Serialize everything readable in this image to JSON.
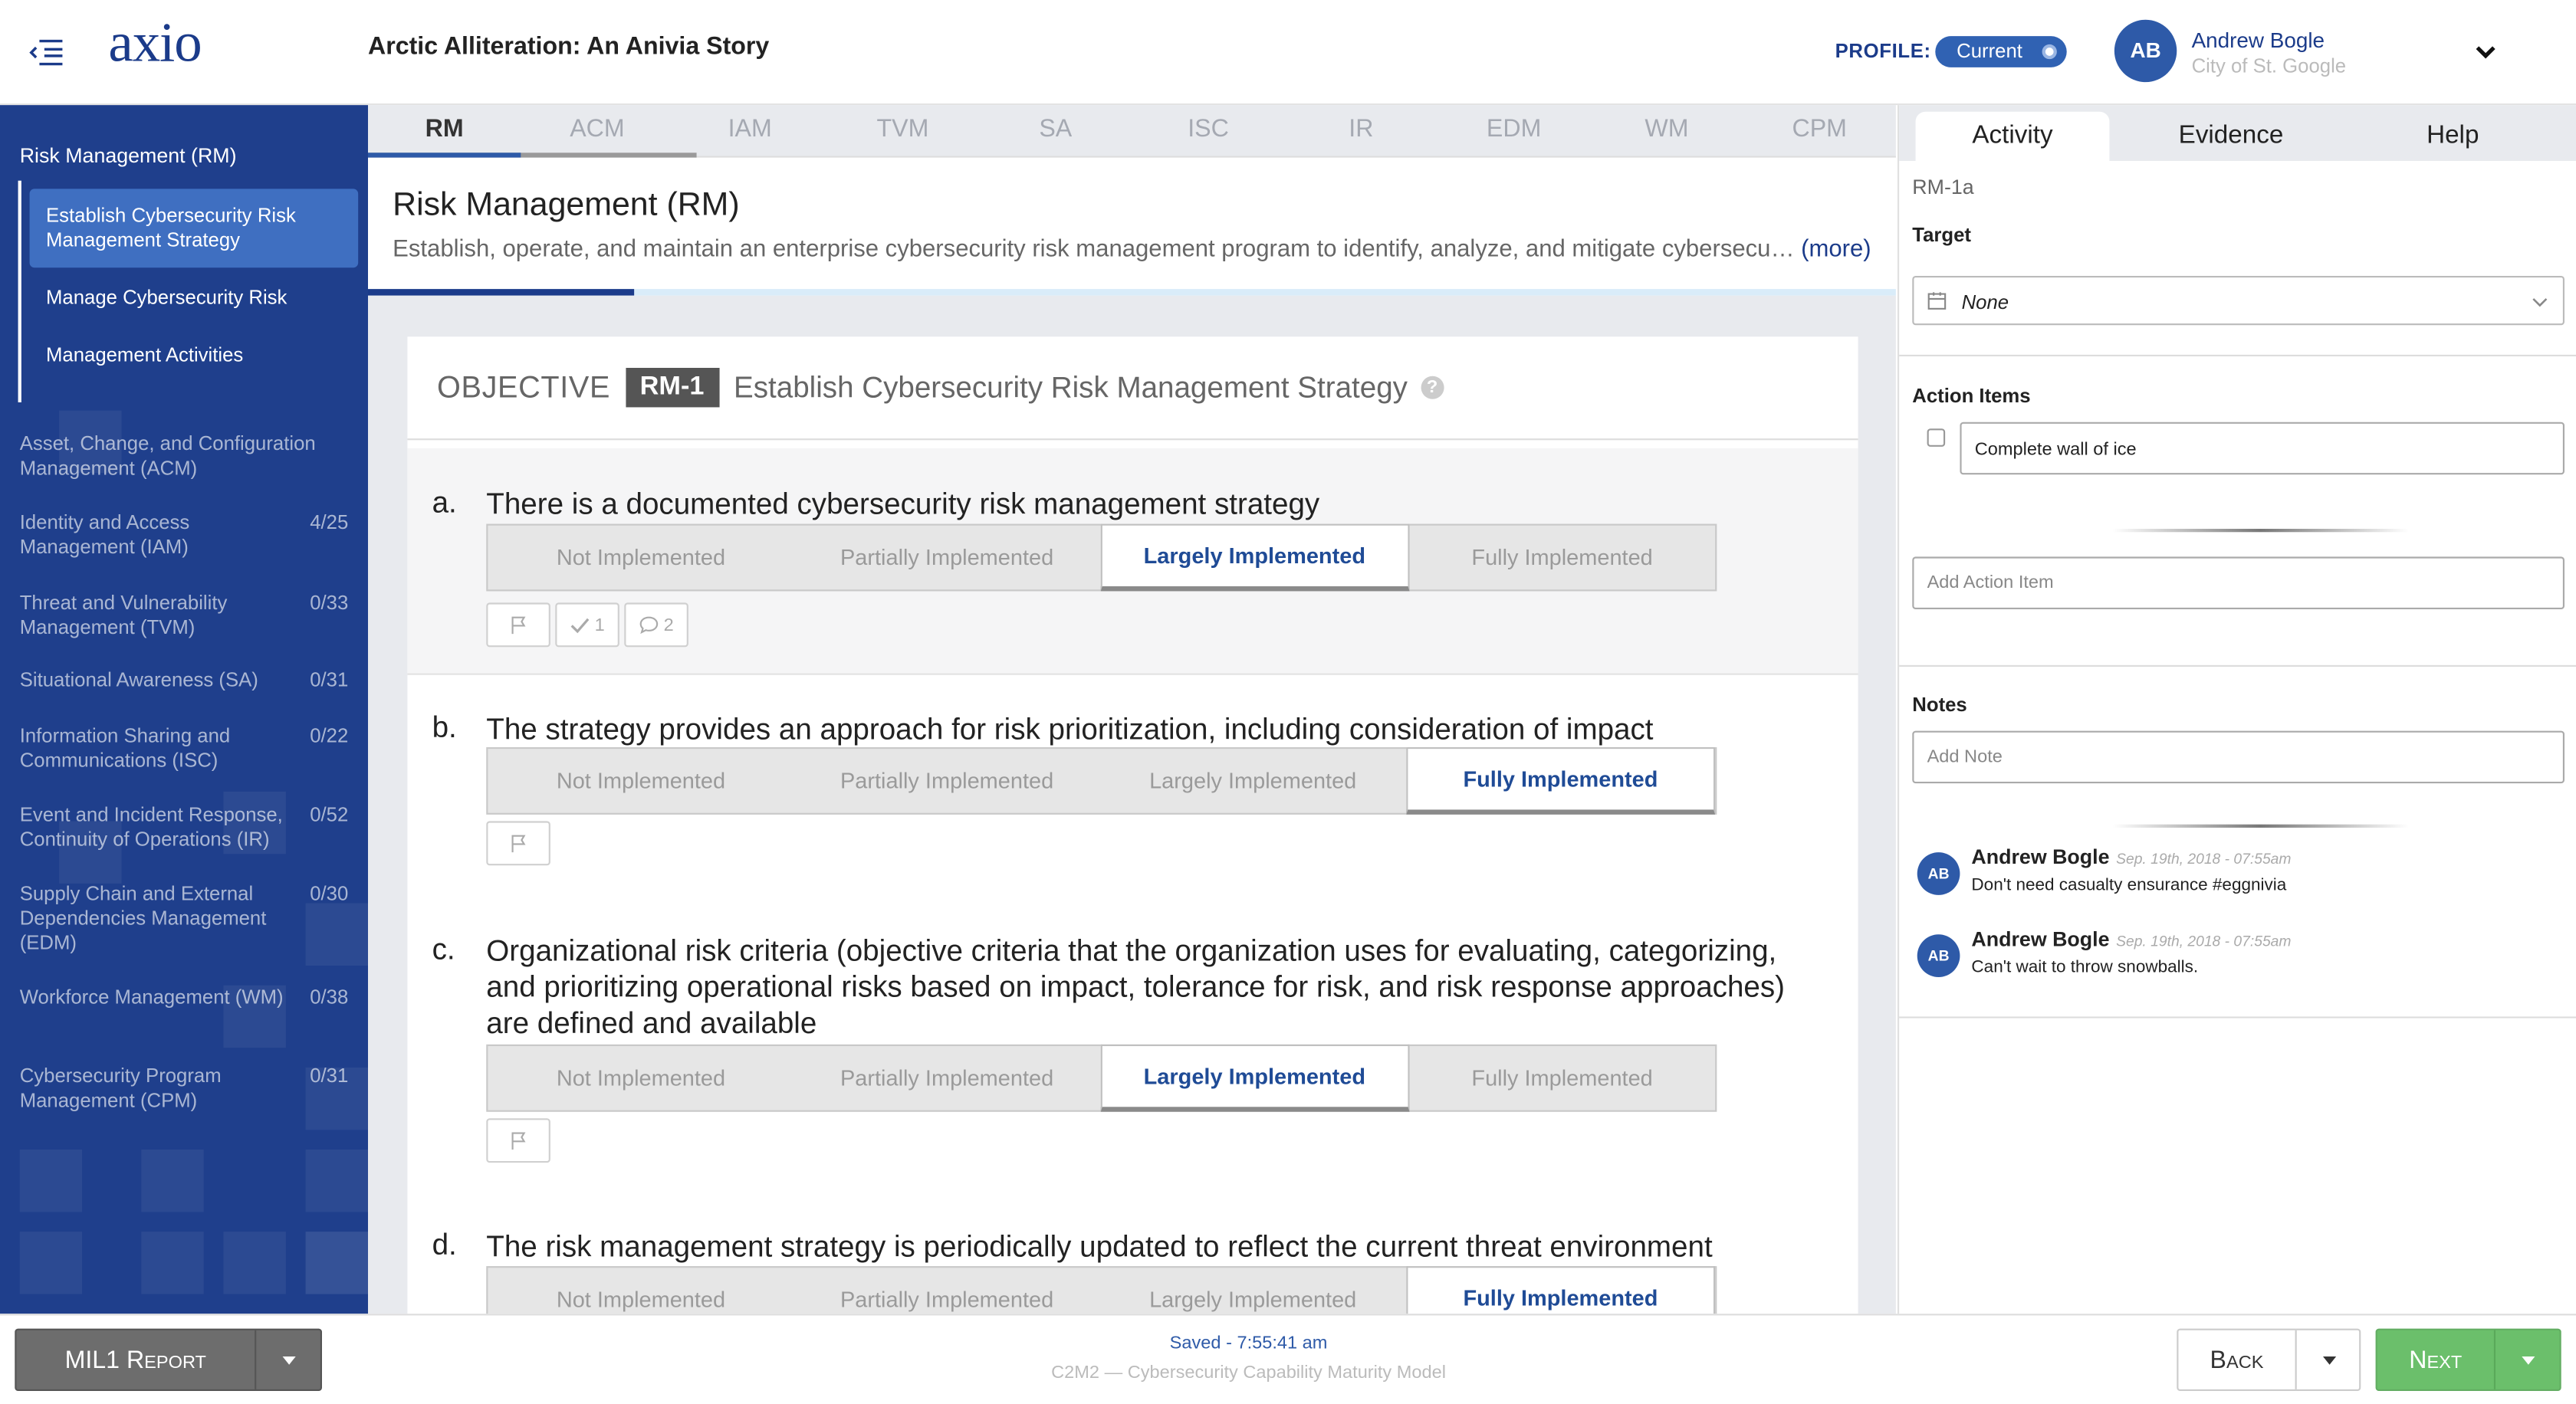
{
  "header": {
    "logo": "axio",
    "page_title": "Arctic Alliteration: An Anivia Story",
    "profile_label": "PROFILE:",
    "profile_toggle": "Current",
    "user_initials": "AB",
    "user_name": "Andrew Bogle",
    "user_org": "City of St. Google"
  },
  "sidebar": {
    "active_domain": "Risk Management (RM)",
    "sub_items": [
      {
        "label": "Establish Cybersecurity Risk Management Strategy",
        "active": true
      },
      {
        "label": "Manage Cybersecurity Risk",
        "active": false
      },
      {
        "label": "Management Activities",
        "active": false
      }
    ],
    "domains": [
      {
        "label": "Asset, Change, and Configuration Management (ACM)",
        "count": ""
      },
      {
        "label": "Identity and Access Management (IAM)",
        "count": "4/25"
      },
      {
        "label": "Threat and Vulnerability Management (TVM)",
        "count": "0/33"
      },
      {
        "label": "Situational Awareness (SA)",
        "count": "0/31"
      },
      {
        "label": "Information Sharing and Communications (ISC)",
        "count": "0/22"
      },
      {
        "label": "Event and Incident Response, Continuity of Operations (IR)",
        "count": "0/52"
      },
      {
        "label": "Supply Chain and External Dependencies Management (EDM)",
        "count": "0/30"
      },
      {
        "label": "Workforce Management (WM)",
        "count": "0/38"
      },
      {
        "label": "Cybersecurity Program Management (CPM)",
        "count": "0/31"
      }
    ]
  },
  "tabs": [
    "RM",
    "ACM",
    "IAM",
    "TVM",
    "SA",
    "ISC",
    "IR",
    "EDM",
    "WM",
    "CPM"
  ],
  "active_tab": "RM",
  "section": {
    "title": "Risk Management (RM)",
    "description": "Establish, operate, and maintain an enterprise cybersecurity risk management program to identify, analyze, and mitigate cybersecu…",
    "more": "(more)"
  },
  "objective": {
    "label": "OBJECTIVE",
    "id": "RM-1",
    "text": "Establish Cybersecurity Risk Management Strategy",
    "help_glyph": "?"
  },
  "rating_options": [
    "Not Implemented",
    "Partially Implemented",
    "Largely Implemented",
    "Fully Implemented"
  ],
  "questions": [
    {
      "letter": "a.",
      "text": "There is a documented cybersecurity risk management strategy",
      "selected": "Largely Implemented",
      "action_count": "1",
      "comment_count": "2"
    },
    {
      "letter": "b.",
      "text": "The strategy provides an approach for risk prioritization, including consideration of impact",
      "selected": "Fully Implemented"
    },
    {
      "letter": "c.",
      "text": "Organizational risk criteria (objective criteria that the organization uses for evaluating, categorizing, and prioritizing operational risks based on impact, tolerance for risk, and risk response approaches) are defined and available",
      "selected": "Largely Implemented"
    },
    {
      "letter": "d.",
      "text": "The risk management strategy is periodically updated to reflect the current threat environment",
      "selected": "Fully Implemented"
    }
  ],
  "right_panel": {
    "tabs": [
      "Activity",
      "Evidence",
      "Help"
    ],
    "active_tab": "Activity",
    "practice_id": "RM-1a",
    "target_label": "Target",
    "target_value": "None",
    "action_items_label": "Action Items",
    "action_items": [
      {
        "text": "Complete wall of ice",
        "checked": false
      }
    ],
    "add_action_placeholder": "Add Action Item",
    "notes_label": "Notes",
    "add_note_placeholder": "Add Note",
    "notes": [
      {
        "initials": "AB",
        "author": "Andrew Bogle",
        "date": "Sep. 19th, 2018 - 07:55am",
        "text": "Don't need casualty ensurance #eggnivia"
      },
      {
        "initials": "AB",
        "author": "Andrew Bogle",
        "date": "Sep. 19th, 2018 - 07:55am",
        "text": "Can't wait to throw snowballs."
      }
    ]
  },
  "footer": {
    "report_button": "MIL1 Report",
    "saved_status": "Saved - 7:55:41 am",
    "model_name": "C2M2 — Cybersecurity Capability Maturity Model",
    "back_button": "Back",
    "next_button": "Next"
  },
  "colors": {
    "brand_navy": "#1b3b8a",
    "sidebar_bg": "#1f3f8c",
    "sidebar_active": "#3f6fc1",
    "accent_blue": "#2e5aa8",
    "next_green": "#6bbf6b",
    "report_gray": "#6d6d6d"
  }
}
